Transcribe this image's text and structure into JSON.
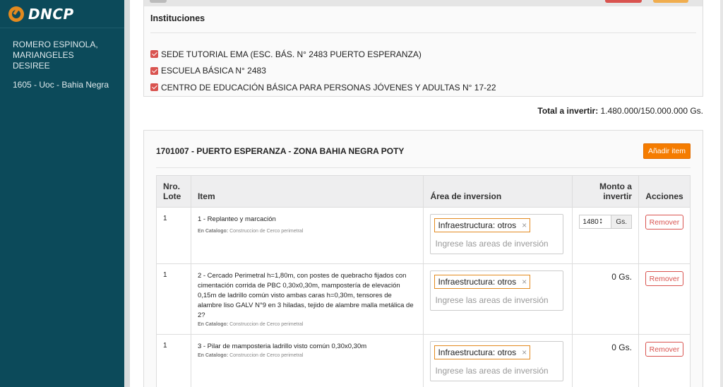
{
  "brand": {
    "logo_text": "DNCP"
  },
  "user": {
    "name": "ROMERO ESPINOLA, MARIANGELES DESIREE",
    "unit": "1605 - Uoc - Bahia Negra"
  },
  "instituciones": {
    "title": "Instituciones",
    "items": [
      {
        "label": "SEDE TUTORIAL EMA (ESC. BÁS. N° 2483 PUERTO ESPERANZA)",
        "checked": true
      },
      {
        "label": "ESCUELA BÁSICA N° 2483",
        "checked": true
      },
      {
        "label": "CENTRO DE EDUCACIÓN BÁSICA PARA PERSONAS JÓVENES Y ADULTAS N° 17-22",
        "checked": true
      }
    ]
  },
  "total": {
    "label": "Total a invertir:",
    "value": "1.480.000/150.000.000 Gs."
  },
  "lote": {
    "title": "1701007 - PUERTO ESPERANZA - ZONA BAHIA NEGRA POTY",
    "add_button": "Añadir item",
    "columns": {
      "nro": "Nro. Lote",
      "item": "Item",
      "area": "Área de inversion",
      "monto": "Monto a invertir",
      "acciones": "Acciones"
    },
    "catalog_label": "En Catalogo:",
    "area_placeholder": "Ingrese las areas de inversión",
    "remove_label": "Remover",
    "rows": [
      {
        "nro": "1",
        "desc": "1 - Replanteo y marcación",
        "catalog": "Construccion de Cerco perimetral",
        "area_tag": "Infraestructura: otros",
        "monto_input": "1480",
        "monto_suffix": "Gs.",
        "monto": ""
      },
      {
        "nro": "1",
        "desc": "2 - Cercado Perimetral h=1,80m, con postes de quebracho fijados con cimentación corrida de PBC 0,30x0,30m, mampostería de elevación 0,15m de ladrillo común visto ambas caras h=0,30m, tensores de alambre liso GALV N°9 en 3 hiladas, tejido de alambre malla metálica de 2?",
        "catalog": "Construccion de Cerco perimetral",
        "area_tag": "Infraestructura: otros",
        "monto": "0 Gs."
      },
      {
        "nro": "1",
        "desc": "3 - Pilar de mamposteria ladrillo visto común 0,30x0,30m",
        "catalog": "Construccion de Cerco perimetral",
        "area_tag": "Infraestructura: otros",
        "monto": "0 Gs."
      }
    ]
  },
  "colors": {
    "sidebar": "#0c4a5a",
    "accent": "#f57c00",
    "danger": "#d9534f",
    "tag_border": "#e38a1f"
  },
  "icons": {
    "logo": "dncp-logo-icon",
    "checkbox": "checkbox-checked-icon",
    "remove_tag": "close-icon",
    "spinner": "spinner-arrows-icon"
  }
}
